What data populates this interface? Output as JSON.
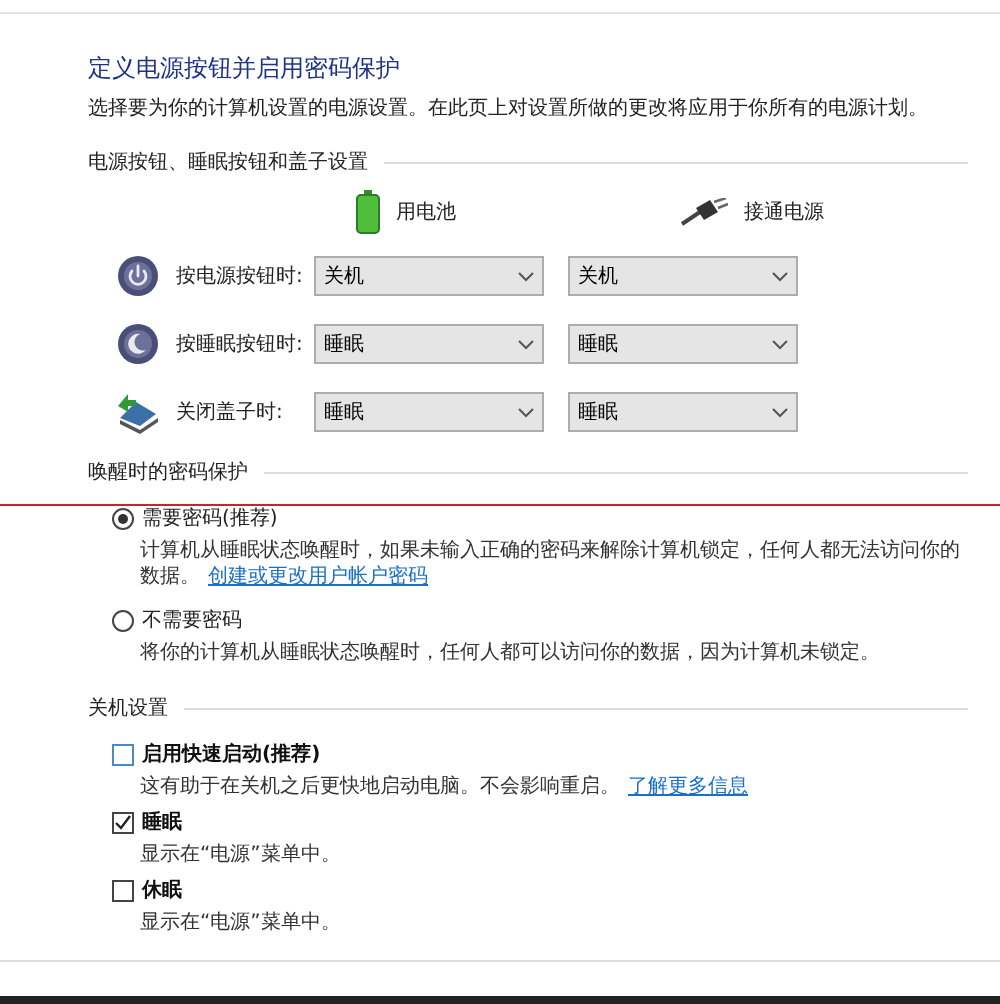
{
  "title": "定义电源按钮并启用密码保护",
  "description": "选择要为你的计算机设置的电源设置。在此页上对设置所做的更改将应用于你所有的电源计划。",
  "power_section": {
    "heading": "电源按钮、睡眠按钮和盖子设置",
    "columns": [
      {
        "kind": "battery",
        "label": "用电池"
      },
      {
        "kind": "plug",
        "label": "接通电源"
      }
    ],
    "rows": [
      {
        "kind": "power",
        "label": "按电源按钮时:",
        "battery": "关机",
        "plugged": "关机"
      },
      {
        "kind": "sleep",
        "label": "按睡眠按钮时:",
        "battery": "睡眠",
        "plugged": "睡眠"
      },
      {
        "kind": "lid",
        "label": "关闭盖子时:",
        "battery": "睡眠",
        "plugged": "睡眠"
      }
    ]
  },
  "password_section": {
    "heading": "唤醒时的密码保护",
    "options": [
      {
        "label": "需要密码(推荐)",
        "selected": true,
        "description": "计算机从睡眠状态唤醒时，如果未输入正确的密码来解除计算机锁定，任何人都无法访问你的数据。",
        "link": "创建或更改用户帐户密码"
      },
      {
        "label": "不需要密码",
        "selected": false,
        "description": "将你的计算机从睡眠状态唤醒时，任何人都可以访问你的数据，因为计算机未锁定。"
      }
    ]
  },
  "shutdown_section": {
    "heading": "关机设置",
    "options": [
      {
        "label": "启用快速启动(推荐)",
        "checked": false,
        "description": "这有助于在关机之后更快地启动电脑。不会影响重启。",
        "link": "了解更多信息"
      },
      {
        "label": "睡眠",
        "checked": true,
        "description": "显示在“电源”菜单中。"
      },
      {
        "label": "休眠",
        "checked": false,
        "description": "显示在“电源”菜单中。"
      }
    ]
  }
}
